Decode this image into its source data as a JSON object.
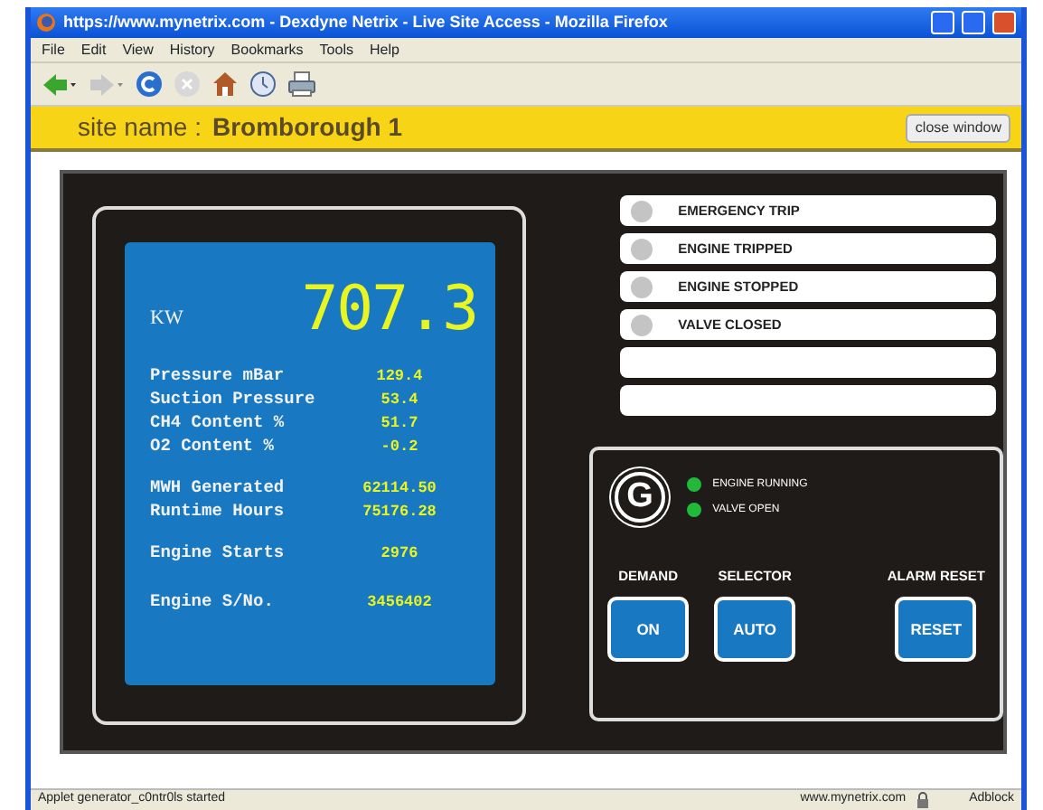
{
  "window": {
    "title": "https://www.mynetrix.com - Dexdyne Netrix - Live Site Access - Mozilla Firefox"
  },
  "menu": [
    "File",
    "Edit",
    "View",
    "History",
    "Bookmarks",
    "Tools",
    "Help"
  ],
  "site_bar": {
    "label": "site name :",
    "site": "Bromborough 1",
    "close_button": "close window"
  },
  "display": {
    "main_label": "KW",
    "main_value": "707.3",
    "groups": [
      [
        {
          "label": "Pressure mBar",
          "value": "129.4"
        },
        {
          "label": "Suction Pressure",
          "value": "53.4"
        },
        {
          "label": "CH4 Content %",
          "value": "51.7"
        },
        {
          "label": "O2 Content %",
          "value": "-0.2"
        }
      ],
      [
        {
          "label": "MWH Generated",
          "value": "62114.50"
        },
        {
          "label": "Runtime Hours",
          "value": "75176.28"
        }
      ],
      [
        {
          "label": "Engine Starts",
          "value": "2976"
        }
      ],
      [
        {
          "label": "Engine S/No.",
          "value": "3456402"
        }
      ]
    ]
  },
  "alarms": [
    {
      "kind": "lamp",
      "label": "EMERGENCY TRIP",
      "lit": false
    },
    {
      "kind": "lamp",
      "label": "ENGINE TRIPPED",
      "lit": false
    },
    {
      "kind": "lamp",
      "label": "ENGINE STOPPED",
      "lit": false
    },
    {
      "kind": "lamp",
      "label": "VALVE CLOSED",
      "lit": false
    },
    {
      "kind": "blank"
    },
    {
      "kind": "blank"
    }
  ],
  "logo": "G",
  "indicators": [
    {
      "label": "ENGINE RUNNING",
      "lit": true
    },
    {
      "label": "VALVE OPEN",
      "lit": true
    }
  ],
  "controls": [
    {
      "heading": "DEMAND",
      "button": "ON"
    },
    {
      "heading": "SELECTOR",
      "button": "AUTO"
    },
    {
      "heading": "ALARM RESET",
      "button": "RESET"
    }
  ],
  "status_bar": {
    "message": "Applet generator_c0ntr0ls started",
    "site": "www.mynetrix.com",
    "addon": "Adblock"
  }
}
